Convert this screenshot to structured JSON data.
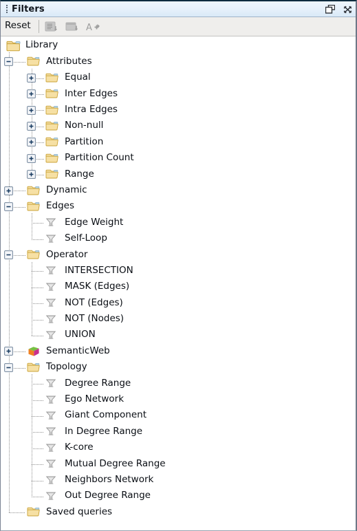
{
  "window": {
    "title": "Filters",
    "drag_handle_icon": "drag-dots-icon",
    "float_button_icon": "float-window-icon",
    "close_button_icon": "close-icon"
  },
  "toolbar": {
    "reset_label": "Reset",
    "buttons": [
      {
        "icon": "export-report-icon",
        "enabled": false
      },
      {
        "icon": "export-table-icon",
        "enabled": false
      },
      {
        "icon": "font-size-icon",
        "enabled": false
      }
    ]
  },
  "colors": {
    "title_bar_top": "#eef6fc",
    "title_bar_bottom": "#d9e9f7",
    "toolbar_bg": "#efeeec",
    "tree_bg": "#ffffff",
    "folder_fill": "#f6e0a4",
    "folder_border": "#c9a236",
    "funnel_grey": "#b6b6b6",
    "text": "#0a0e14",
    "cube_top": "#77c043",
    "cube_left": "#ef8022",
    "cube_right": "#c9308e"
  },
  "tree": {
    "root": {
      "label": "Library",
      "icon": "folder-open-icon",
      "expanded": true
    },
    "nodes": [
      {
        "label": "Attributes",
        "level": 1,
        "icon": "folder-icon",
        "toggle": "minus",
        "expanded": true
      },
      {
        "label": "Equal",
        "level": 2,
        "icon": "folder-icon",
        "toggle": "plus",
        "expanded": false
      },
      {
        "label": "Inter Edges",
        "level": 2,
        "icon": "folder-icon",
        "toggle": "plus",
        "expanded": false
      },
      {
        "label": "Intra Edges",
        "level": 2,
        "icon": "folder-icon",
        "toggle": "plus",
        "expanded": false
      },
      {
        "label": "Non-null",
        "level": 2,
        "icon": "folder-icon",
        "toggle": "plus",
        "expanded": false
      },
      {
        "label": "Partition",
        "level": 2,
        "icon": "folder-icon",
        "toggle": "plus",
        "expanded": false
      },
      {
        "label": "Partition Count",
        "level": 2,
        "icon": "folder-icon",
        "toggle": "plus",
        "expanded": false
      },
      {
        "label": "Range",
        "level": 2,
        "icon": "folder-icon",
        "toggle": "plus",
        "expanded": false
      },
      {
        "label": "Dynamic",
        "level": 1,
        "icon": "folder-icon",
        "toggle": "plus",
        "expanded": false
      },
      {
        "label": "Edges",
        "level": 1,
        "icon": "folder-icon",
        "toggle": "minus",
        "expanded": true
      },
      {
        "label": "Edge Weight",
        "level": 2,
        "icon": "filter-funnel-icon",
        "toggle": "none"
      },
      {
        "label": "Self-Loop",
        "level": 2,
        "icon": "filter-funnel-icon",
        "toggle": "none"
      },
      {
        "label": "Operator",
        "level": 1,
        "icon": "folder-icon",
        "toggle": "minus",
        "expanded": true
      },
      {
        "label": "INTERSECTION",
        "level": 2,
        "icon": "filter-funnel-icon",
        "toggle": "none"
      },
      {
        "label": "MASK (Edges)",
        "level": 2,
        "icon": "filter-funnel-icon",
        "toggle": "none"
      },
      {
        "label": "NOT (Edges)",
        "level": 2,
        "icon": "filter-funnel-icon",
        "toggle": "none"
      },
      {
        "label": "NOT (Nodes)",
        "level": 2,
        "icon": "filter-funnel-icon",
        "toggle": "none"
      },
      {
        "label": "UNION",
        "level": 2,
        "icon": "filter-funnel-icon",
        "toggle": "none"
      },
      {
        "label": "SemanticWeb",
        "level": 1,
        "icon": "semantic-cube-icon",
        "toggle": "plus",
        "expanded": false
      },
      {
        "label": "Topology",
        "level": 1,
        "icon": "folder-icon",
        "toggle": "minus",
        "expanded": true
      },
      {
        "label": "Degree Range",
        "level": 2,
        "icon": "filter-funnel-icon",
        "toggle": "none"
      },
      {
        "label": "Ego Network",
        "level": 2,
        "icon": "filter-funnel-icon",
        "toggle": "none"
      },
      {
        "label": "Giant Component",
        "level": 2,
        "icon": "filter-funnel-icon",
        "toggle": "none"
      },
      {
        "label": "In Degree Range",
        "level": 2,
        "icon": "filter-funnel-icon",
        "toggle": "none"
      },
      {
        "label": "K-core",
        "level": 2,
        "icon": "filter-funnel-icon",
        "toggle": "none"
      },
      {
        "label": "Mutual Degree Range",
        "level": 2,
        "icon": "filter-funnel-icon",
        "toggle": "none"
      },
      {
        "label": "Neighbors Network",
        "level": 2,
        "icon": "filter-funnel-icon",
        "toggle": "none"
      },
      {
        "label": "Out Degree Range",
        "level": 2,
        "icon": "filter-funnel-icon",
        "toggle": "none"
      },
      {
        "label": "Saved queries",
        "level": 1,
        "icon": "folder-icon",
        "toggle": "none"
      }
    ]
  }
}
